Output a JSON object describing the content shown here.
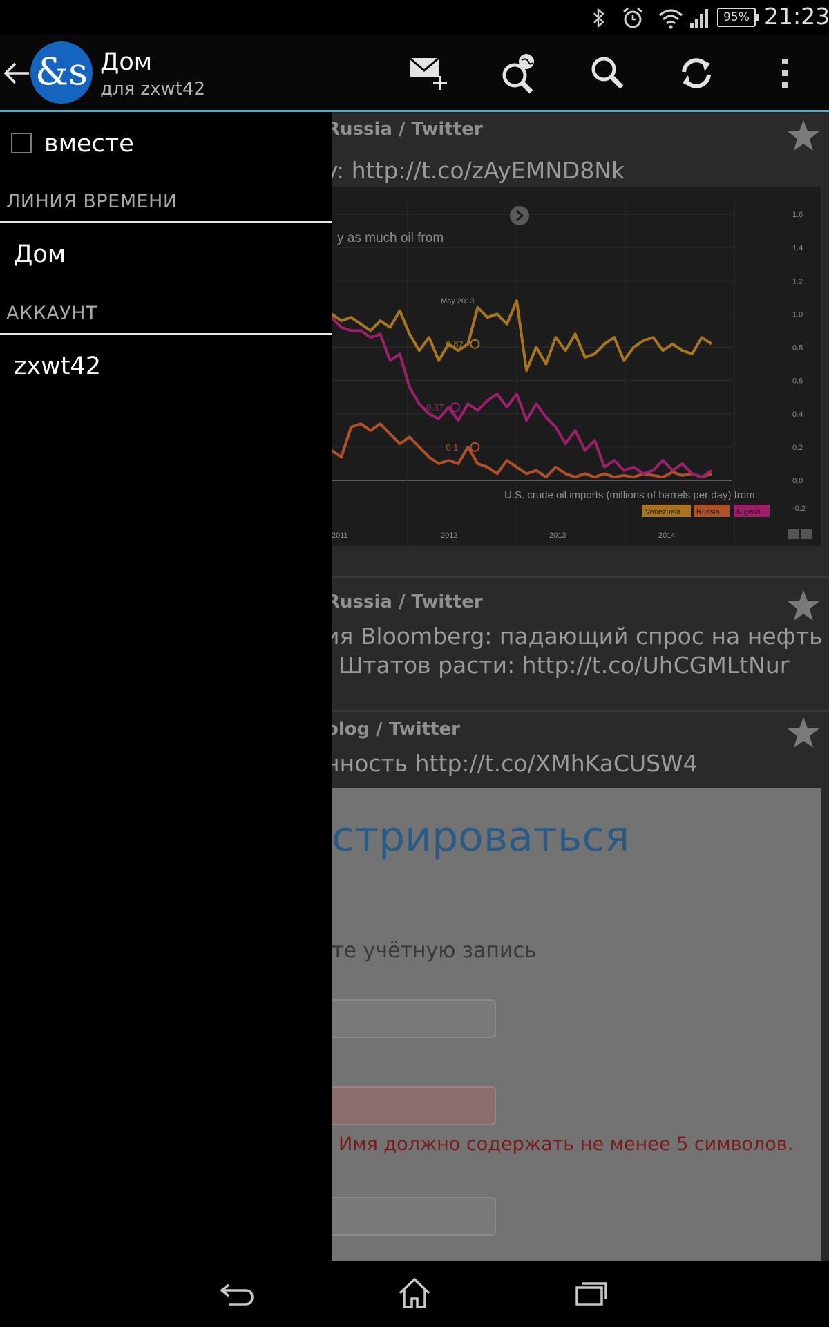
{
  "status_bar": {
    "icons": [
      "bluetooth-icon",
      "alarm-icon",
      "wifi-icon",
      "signal-icon"
    ],
    "battery": "95%",
    "time": "21:23"
  },
  "action_bar": {
    "title": "Дом",
    "subtitle": "для zxwt42",
    "logo_text": "&s",
    "actions": [
      "compose-message-icon",
      "global-search-icon",
      "search-icon",
      "refresh-icon",
      "overflow-menu-icon"
    ]
  },
  "drawer": {
    "together_label": "вместе",
    "together_checked": false,
    "sections": [
      {
        "header": "ЛИНИЯ ВРЕМЕНИ",
        "items": [
          "Дом"
        ]
      },
      {
        "header": "АККАУНТ",
        "items": [
          "zxwt42"
        ]
      }
    ]
  },
  "timeline": {
    "tweets": [
      {
        "author": "Russia / Twitter",
        "text_lines": [
          "y: http://t.co/zAyEMND8Nk"
        ],
        "has_chart": true
      },
      {
        "author": "Russia / Twitter",
        "text_lines": [
          "ия Bloomberg: падающий спрос на нефть",
          "Штатов расти: http://t.co/UhCGMLtNur"
        ]
      },
      {
        "author": "olog / Twitter",
        "text_lines": [
          "нность http://t.co/XMhKaCUSW4"
        ],
        "signup_image": {
          "title": "стрироваться",
          "hint": "те учётную запись",
          "error": "Имя должно содержать не менее 5 символов."
        }
      }
    ]
  },
  "chart_data": {
    "type": "line",
    "title": "y as much oil from",
    "caption": "U.S. crude oil imports (millions of barrels per day) from:",
    "x_ticks": [
      "2011",
      "2012",
      "2013",
      "2014"
    ],
    "y_ticks": [
      "1.6",
      "1.4",
      "1.2",
      "1.0",
      "0.8",
      "0.6",
      "0.4",
      "0.2",
      "0.0",
      "-0.2"
    ],
    "ylim": [
      -0.2,
      1.6
    ],
    "marker_label": "May 2013",
    "series": [
      {
        "name": "Venezuela",
        "color": "#a8741f",
        "values": [
          1.0,
          0.96,
          0.98,
          0.94,
          0.9,
          0.96,
          0.92,
          1.02,
          0.88,
          0.78,
          0.86,
          0.72,
          0.82,
          0.78,
          0.82,
          1.04,
          0.98,
          1.0,
          0.94,
          1.08,
          0.66,
          0.8,
          0.7,
          0.86,
          0.78,
          0.88,
          0.74,
          0.76,
          0.82,
          0.86,
          0.72,
          0.8,
          0.84,
          0.86,
          0.78,
          0.82,
          0.78,
          0.76,
          0.86,
          0.82
        ]
      },
      {
        "name": "Russia",
        "color": "#b0502a",
        "values": [
          0.18,
          0.14,
          0.32,
          0.34,
          0.3,
          0.34,
          0.28,
          0.22,
          0.26,
          0.2,
          0.14,
          0.1,
          0.12,
          0.1,
          0.2,
          0.1,
          0.08,
          0.04,
          0.12,
          0.08,
          0.04,
          0.06,
          0.02,
          0.08,
          0.04,
          0.02,
          0.04,
          0.02,
          0.04,
          0.02,
          0.03,
          0.02,
          0.04,
          0.03,
          0.02,
          0.05,
          0.03,
          0.04,
          0.02,
          0.04
        ]
      },
      {
        "name": "Nigeria",
        "color": "#9c1f6c",
        "values": [
          0.98,
          0.92,
          0.9,
          0.9,
          0.86,
          0.88,
          0.72,
          0.76,
          0.56,
          0.46,
          0.4,
          0.37,
          0.44,
          0.36,
          0.46,
          0.42,
          0.48,
          0.52,
          0.44,
          0.52,
          0.36,
          0.46,
          0.38,
          0.32,
          0.22,
          0.3,
          0.18,
          0.24,
          0.08,
          0.12,
          0.06,
          0.08,
          0.04,
          0.06,
          0.12,
          0.06,
          0.1,
          0.04,
          0.02,
          0.06
        ]
      }
    ],
    "annotations": [
      {
        "series": "Venezuela",
        "label": "0.82"
      },
      {
        "series": "Nigeria",
        "label": "0.37"
      },
      {
        "series": "Russia",
        "label": "0.1"
      }
    ]
  }
}
